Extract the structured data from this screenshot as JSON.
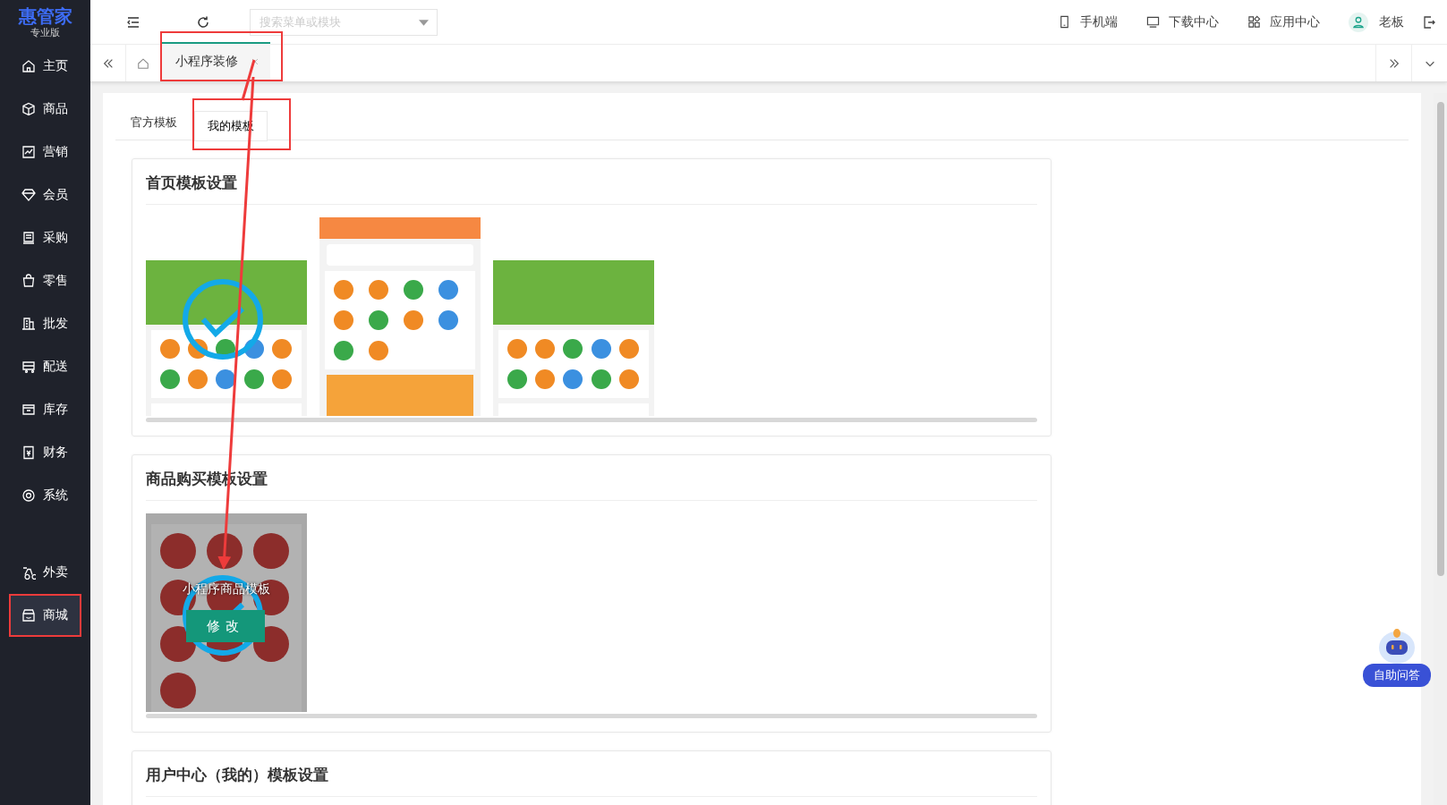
{
  "logo": {
    "title": "惠管家",
    "subtitle": "专业版"
  },
  "sidebar": {
    "items": [
      {
        "label": "主页",
        "selected": false,
        "highlighted": false
      },
      {
        "label": "商品",
        "selected": false,
        "highlighted": false
      },
      {
        "label": "营销",
        "selected": false,
        "highlighted": false
      },
      {
        "label": "会员",
        "selected": false,
        "highlighted": false
      },
      {
        "label": "采购",
        "selected": false,
        "highlighted": false
      },
      {
        "label": "零售",
        "selected": false,
        "highlighted": false
      },
      {
        "label": "批发",
        "selected": false,
        "highlighted": false
      },
      {
        "label": "配送",
        "selected": false,
        "highlighted": false
      },
      {
        "label": "库存",
        "selected": false,
        "highlighted": false
      },
      {
        "label": "财务",
        "selected": false,
        "highlighted": false
      },
      {
        "label": "系统",
        "selected": false,
        "highlighted": false
      }
    ],
    "extra_items": [
      {
        "label": "外卖",
        "selected": false,
        "highlighted": false
      },
      {
        "label": "商城",
        "selected": true,
        "highlighted": true
      }
    ]
  },
  "header": {
    "search": {
      "placeholder": "搜索菜单或模块"
    },
    "links": [
      "手机端",
      "下载中心",
      "应用中心"
    ],
    "user": "老板"
  },
  "page_tabs": [
    {
      "label": "小程序装修",
      "selected": true,
      "highlighted": true
    }
  ],
  "template_tabs": [
    {
      "label": "官方模板",
      "selected": false,
      "highlighted": false
    },
    {
      "label": "我的模板",
      "selected": true,
      "highlighted": true
    }
  ],
  "sections": [
    {
      "title": "首页模板设置",
      "templates": [
        {
          "kind": "green",
          "selected": true
        },
        {
          "kind": "orange",
          "selected": false
        },
        {
          "kind": "green",
          "selected": false
        }
      ]
    },
    {
      "title": "商品购买模板设置",
      "templates": [
        {
          "kind": "goods",
          "selected": true,
          "hover_title": "小程序商品模板",
          "hover_button": "修改"
        }
      ]
    },
    {
      "title": "用户中心（我的）模板设置"
    }
  ],
  "help_button": "自助问答"
}
